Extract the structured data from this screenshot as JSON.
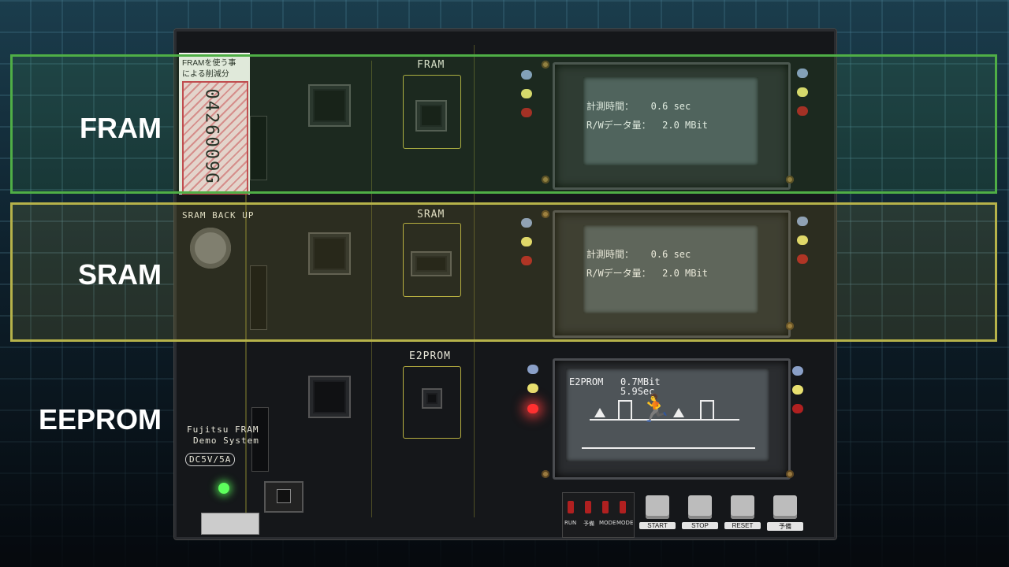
{
  "rows": {
    "fram": "FRAM",
    "sram": "SRAM",
    "eeprom": "EEPROM"
  },
  "board": {
    "fram_silk": "FRAM",
    "sram_silk": "SRAM",
    "e2prom_silk": "E2PROM",
    "sticker_line1": "FRAMを使う事",
    "sticker_line2": "による削減分",
    "counter_digits": "0426009G",
    "sram_backup": "SRAM BACK UP",
    "demo_line1": "Fujitsu FRAM",
    "demo_line2": "Demo System",
    "power_label": "DC5V/5A"
  },
  "displays": {
    "fram": {
      "line1": "計測時間：   0.6 sec",
      "line2": "R/Wデータ量：  2.0 MBit"
    },
    "sram": {
      "line1": "計測時間：   0.6 sec",
      "line2": "R/Wデータ量：  2.0 MBit"
    },
    "eeprom": {
      "line1": "E2PROM   0.7MBit",
      "line2": "         5.9Sec"
    }
  },
  "buttons": {
    "start": "START",
    "stop": "STOP",
    "reset": "RESET",
    "fourth": "予備"
  },
  "status_labels": [
    "RUN",
    "予備",
    "MODE",
    "MODE"
  ],
  "colors": {
    "fram_band": "#4fae46",
    "sram_band": "#b6b24a",
    "led_red_on": "#ff3030"
  }
}
